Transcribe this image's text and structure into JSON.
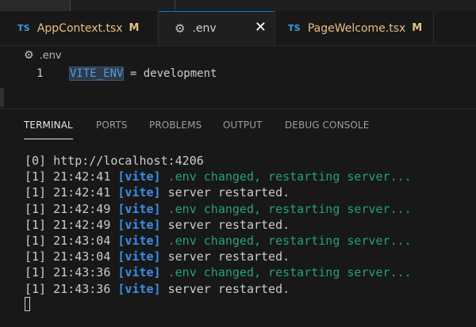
{
  "tabs": [
    {
      "badge": "TS",
      "label": "AppContext.tsx",
      "status": "M"
    },
    {
      "icon": "gear-icon",
      "label": ".env",
      "close": "✕"
    },
    {
      "badge": "TS",
      "label": "PageWelcome.tsx",
      "status": "M"
    }
  ],
  "breadcrumb": {
    "icon": "gear-icon",
    "label": ".env"
  },
  "editor": {
    "line_number": "1",
    "key": "VITE_ENV",
    "operator": " = ",
    "value": "development"
  },
  "panel": {
    "tabs": [
      "TERMINAL",
      "PORTS",
      "PROBLEMS",
      "OUTPUT",
      "DEBUG CONSOLE"
    ],
    "active_tab": "TERMINAL"
  },
  "terminal": {
    "first_line": "[0] http://localhost:4206",
    "lines": [
      {
        "prefix": "[1] 21:42:41 ",
        "tag": "[vite]",
        "msg": " .env changed, restarting server...",
        "kind": "green"
      },
      {
        "prefix": "[1] 21:42:41 ",
        "tag": "[vite]",
        "msg": " server restarted.",
        "kind": "plain"
      },
      {
        "prefix": "[1] 21:42:49 ",
        "tag": "[vite]",
        "msg": " .env changed, restarting server...",
        "kind": "green"
      },
      {
        "prefix": "[1] 21:42:49 ",
        "tag": "[vite]",
        "msg": " server restarted.",
        "kind": "plain"
      },
      {
        "prefix": "[1] 21:43:04 ",
        "tag": "[vite]",
        "msg": " .env changed, restarting server...",
        "kind": "green"
      },
      {
        "prefix": "[1] 21:43:04 ",
        "tag": "[vite]",
        "msg": " server restarted.",
        "kind": "plain"
      },
      {
        "prefix": "[1] 21:43:36 ",
        "tag": "[vite]",
        "msg": " .env changed, restarting server...",
        "kind": "green"
      },
      {
        "prefix": "[1] 21:43:36 ",
        "tag": "[vite]",
        "msg": " server restarted.",
        "kind": "plain"
      }
    ]
  },
  "colors": {
    "background": "#181818",
    "ts_badge": "#3c9be0",
    "modified": "#e8c180",
    "vite_tag": "#3b8eea",
    "restart_msg": "#23a36f",
    "active_border": "#0078d4"
  }
}
